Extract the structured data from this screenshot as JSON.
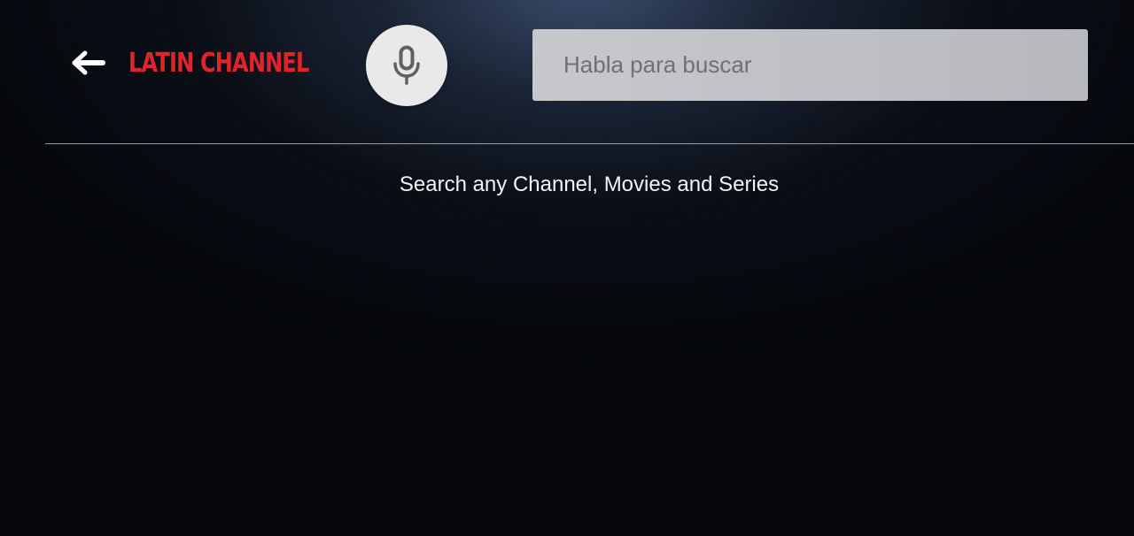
{
  "header": {
    "brand": "LATIN CHANNEL",
    "brand_color": "#e2232a",
    "back_icon": "arrow-left-icon",
    "mic_icon": "microphone-icon"
  },
  "search": {
    "placeholder": "Habla para buscar",
    "value": ""
  },
  "main": {
    "hint": "Search any Channel, Movies and Series"
  }
}
